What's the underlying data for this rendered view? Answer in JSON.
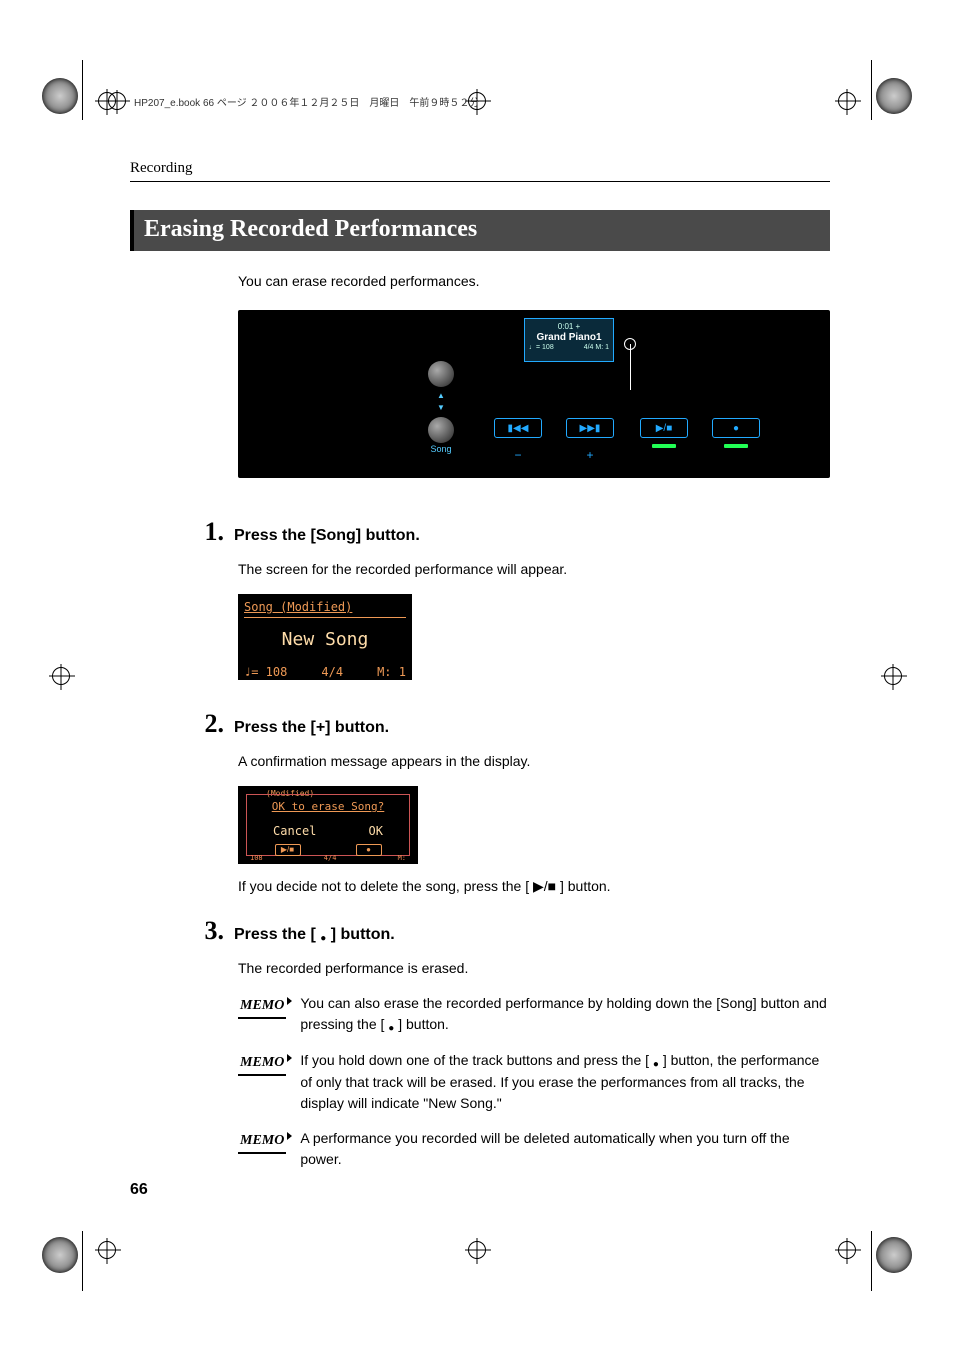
{
  "print_header": "HP207_e.book  66 ページ  ２００６年１２月２５日　月曜日　午前９時５２分",
  "running_header": "Recording",
  "section_title": "Erasing Recorded Performances",
  "intro_text": "You can erase recorded performances.",
  "panel": {
    "display_line1": "0:01 +",
    "display_line2": "Grand Piano1",
    "display_line3_tempo": "♩= 108",
    "display_line3_beat": "4/4  M:   1",
    "song_label": "Song",
    "transport_rew": "▮◀◀",
    "transport_fwd": "▶▶▮",
    "transport_minus": "−",
    "transport_plus": "+",
    "transport_playstop": "▶/■",
    "transport_rec": "●"
  },
  "steps": [
    {
      "num": "1.",
      "title": "Press the [Song] button.",
      "body": "The screen for the recorded performance will appear.",
      "lcd": {
        "top": "Song (Modified)",
        "big": "New Song",
        "tempo": "♩= 108",
        "beat": "4/4",
        "measure": "M:   1"
      }
    },
    {
      "num": "2.",
      "title": "Press the [+] button.",
      "body": "A confirmation message appears in the display.",
      "lcd2": {
        "tab": "(Modified)",
        "question": "OK to erase Song?",
        "cancel": "Cancel",
        "ok": "OK",
        "bot_left": "108",
        "bot_mid": "4/4",
        "bot_right": "M:"
      },
      "after": "If you decide not to delete the song, press the [ ▶/■ ] button."
    },
    {
      "num": "3.",
      "title_before": "Press the [ ",
      "title_after": " ] button.",
      "body": "The recorded performance is erased."
    }
  ],
  "memos": [
    {
      "label": "MEMO",
      "text_before": "You can also erase the recorded performance by holding down the [Song] button and pressing the [ ",
      "text_after": " ] button."
    },
    {
      "label": "MEMO",
      "text_before": "If you hold down one of the track buttons and press the [ ",
      "text_after": " ] button, the performance of only that track will be erased. If you erase the performances from all tracks, the display will indicate \"New Song.\""
    },
    {
      "label": "MEMO",
      "text": "A performance you recorded will be deleted automatically when you turn off the power."
    }
  ],
  "page_number": "66"
}
